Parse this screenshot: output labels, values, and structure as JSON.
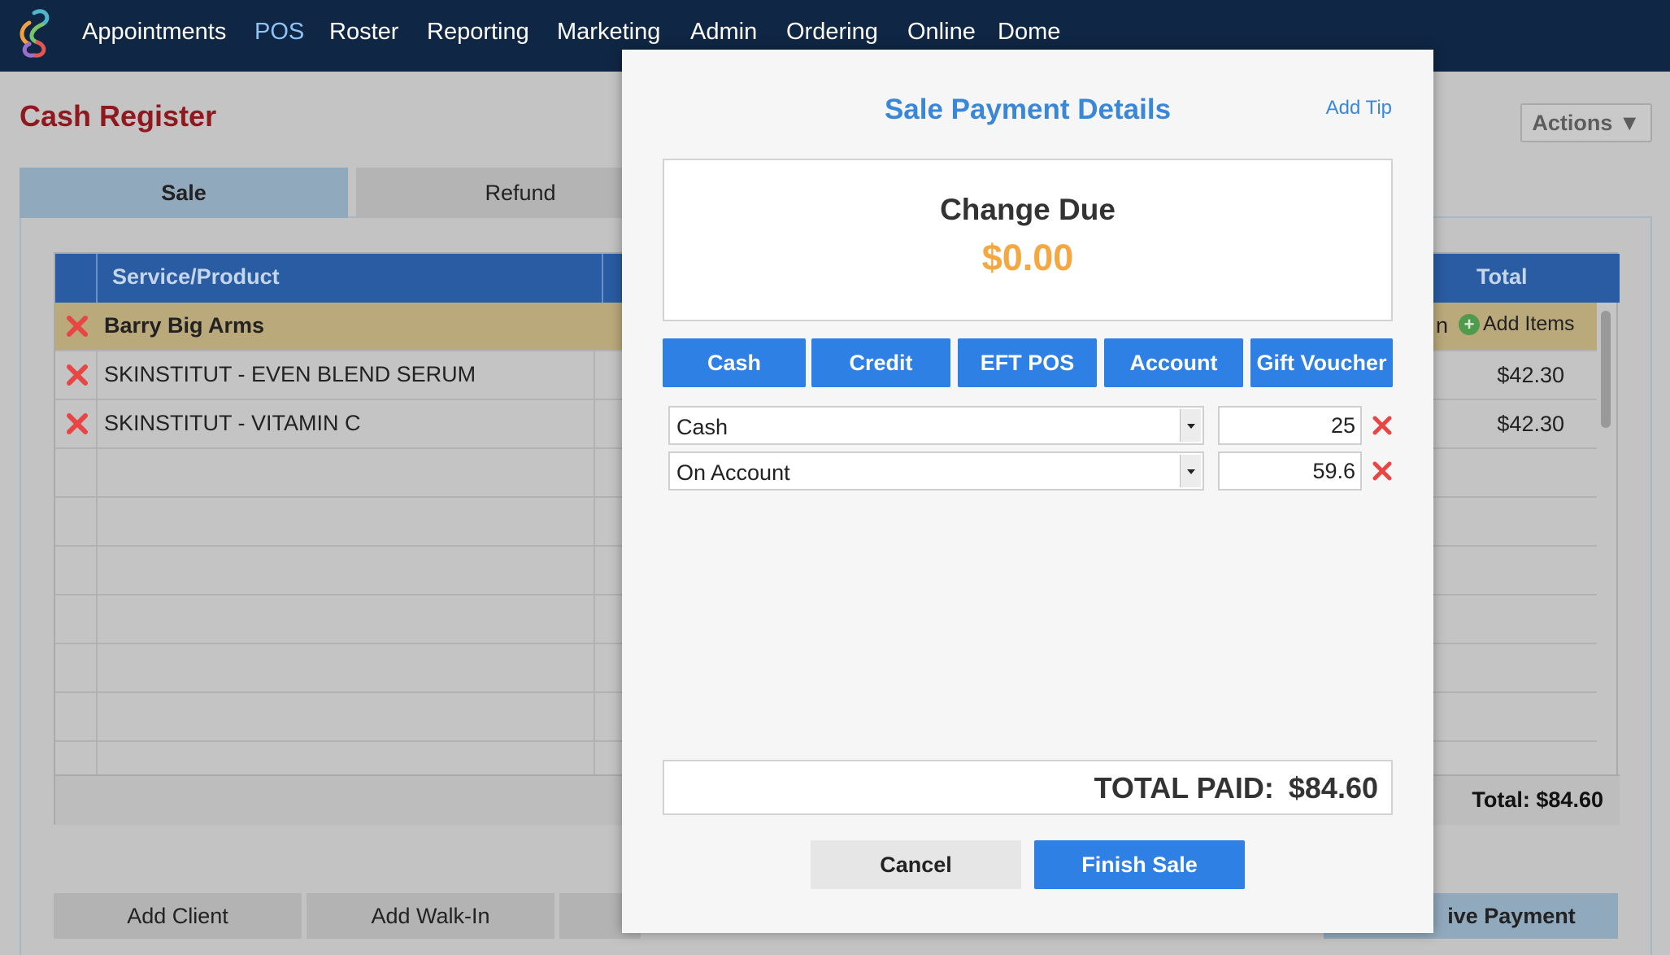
{
  "nav": {
    "items": [
      {
        "label": "Appointments",
        "active": false
      },
      {
        "label": "POS",
        "active": true
      },
      {
        "label": "Roster",
        "active": false
      },
      {
        "label": "Reporting",
        "active": false
      },
      {
        "label": "Marketing",
        "active": false
      },
      {
        "label": "Admin",
        "active": false
      },
      {
        "label": "Ordering",
        "active": false
      },
      {
        "label": "Online",
        "active": false
      },
      {
        "label": "Dome",
        "active": false
      }
    ]
  },
  "page": {
    "title": "Cash Register",
    "actions_label": "Actions ▼",
    "tabs": [
      {
        "label": "Sale",
        "active": true
      },
      {
        "label": "Refund",
        "active": false
      }
    ]
  },
  "grid": {
    "col_service": "Service/Product",
    "col_total": "Total",
    "client_name": "Barry Big Arms",
    "add_items_label": "Add Items",
    "partial_text": "n",
    "rows": [
      {
        "name": "SKINSTITUT - EVEN BLEND SERUM",
        "total": "$42.30"
      },
      {
        "name": "SKINSTITUT - VITAMIN C",
        "total": "$42.30"
      }
    ],
    "total_label": "Total: $84.60"
  },
  "bottom": {
    "add_client": "Add Client",
    "add_walkin": "Add Walk-In",
    "receive_payment": "ive Payment"
  },
  "modal": {
    "title": "Sale Payment Details",
    "add_tip": "Add Tip",
    "change_label": "Change Due",
    "change_amount": "$0.00",
    "methods": [
      "Cash",
      "Credit",
      "EFT POS",
      "Account",
      "Gift Voucher"
    ],
    "payments": [
      {
        "method": "Cash",
        "amount": "25"
      },
      {
        "method": "On Account",
        "amount": "59.6"
      }
    ],
    "total_paid_label": "TOTAL PAID:",
    "total_paid_value": "$84.60",
    "cancel_label": "Cancel",
    "finish_label": "Finish Sale"
  },
  "colors": {
    "nav_bg": "#0f2744",
    "accent_blue": "#2f80e4",
    "title_red": "#8e1a1f",
    "change_orange": "#f5a741",
    "remove_red": "#e84545"
  }
}
